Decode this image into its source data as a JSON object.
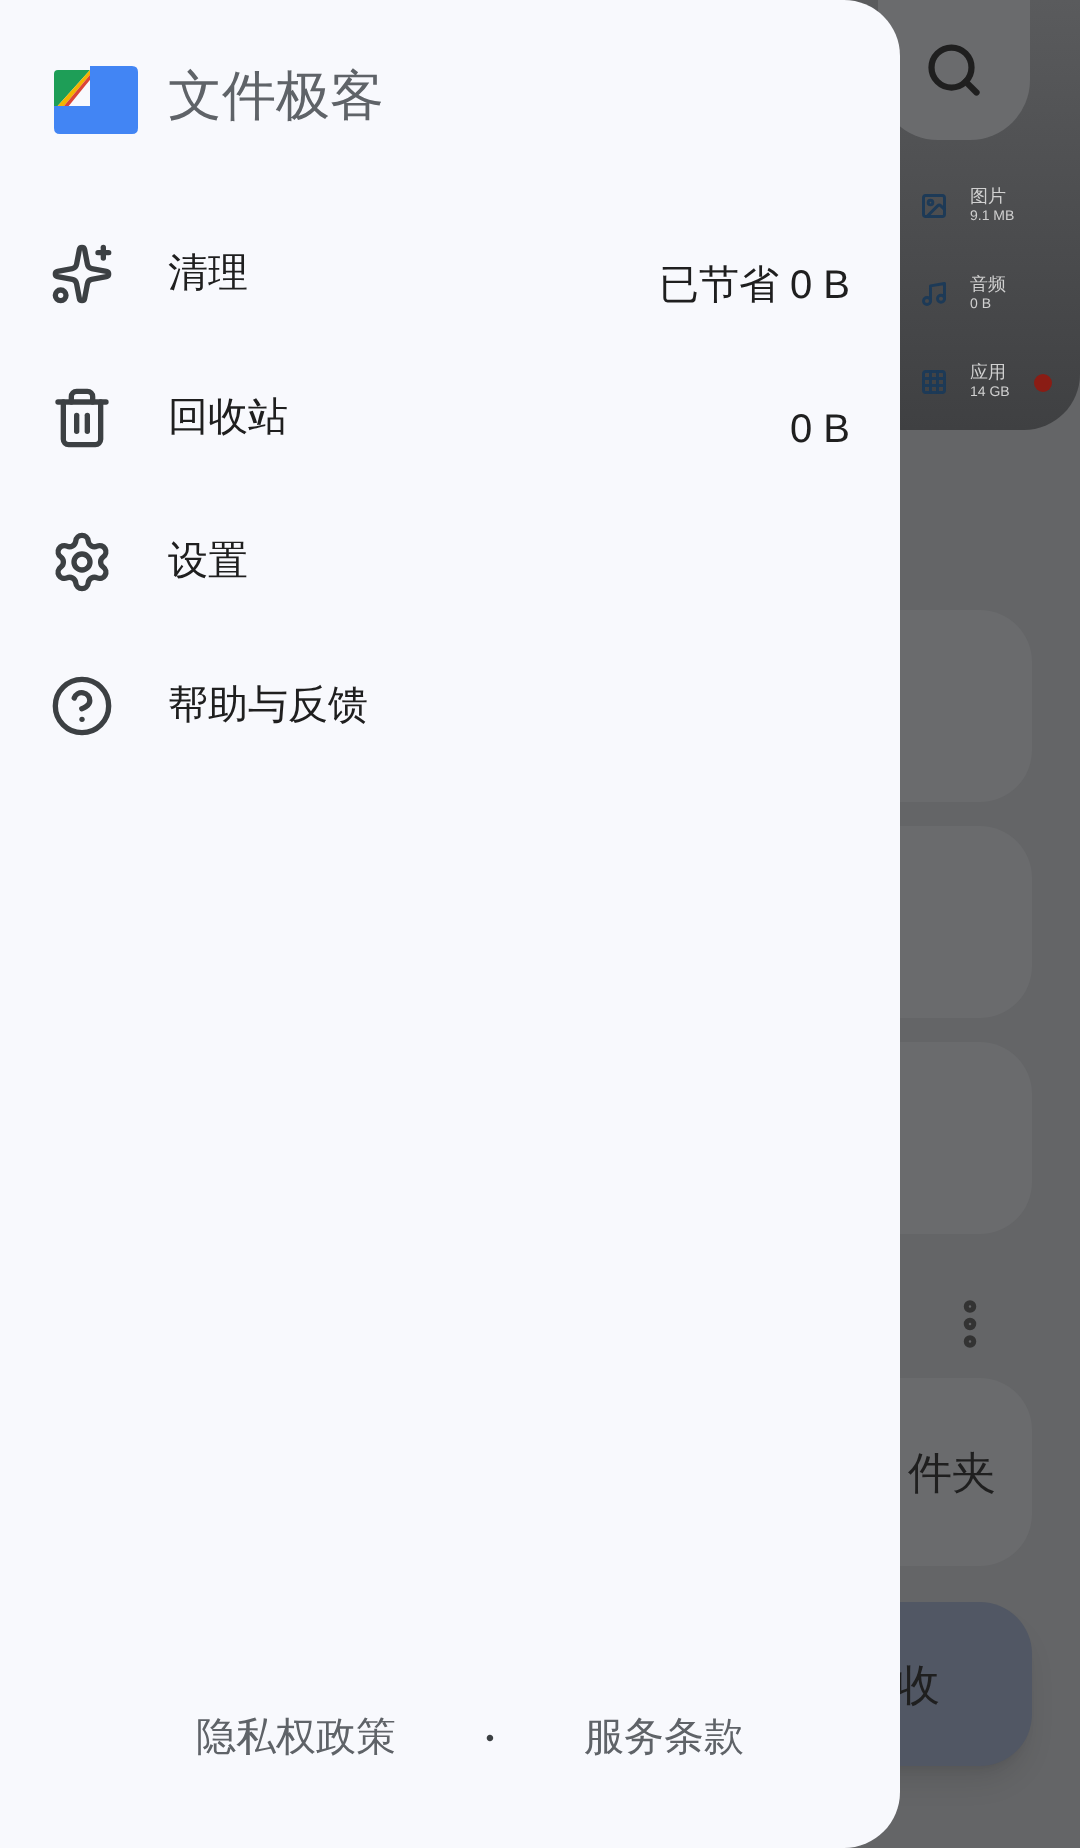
{
  "drawer": {
    "app_title": "文件极客",
    "items": [
      {
        "kind": "clean",
        "label": "清理",
        "value": "已节省 0 B"
      },
      {
        "kind": "trash",
        "label": "回收站",
        "value": "0 B"
      },
      {
        "kind": "settings",
        "label": "设置"
      },
      {
        "kind": "help",
        "label": "帮助与反馈"
      }
    ],
    "footer_links": [
      "隐私权政策",
      "服务条款"
    ],
    "footer_separator": "•"
  },
  "background": {
    "storage_categories": [
      {
        "kind": "images",
        "label": "图片",
        "size": "9.1 MB",
        "alert": false
      },
      {
        "kind": "audio",
        "label": "音频",
        "size": "0 B",
        "alert": false
      },
      {
        "kind": "apps",
        "label": "应用",
        "size": "14 GB",
        "alert": true
      }
    ],
    "folder_card_label": "件夹",
    "action_button_label": "收"
  }
}
